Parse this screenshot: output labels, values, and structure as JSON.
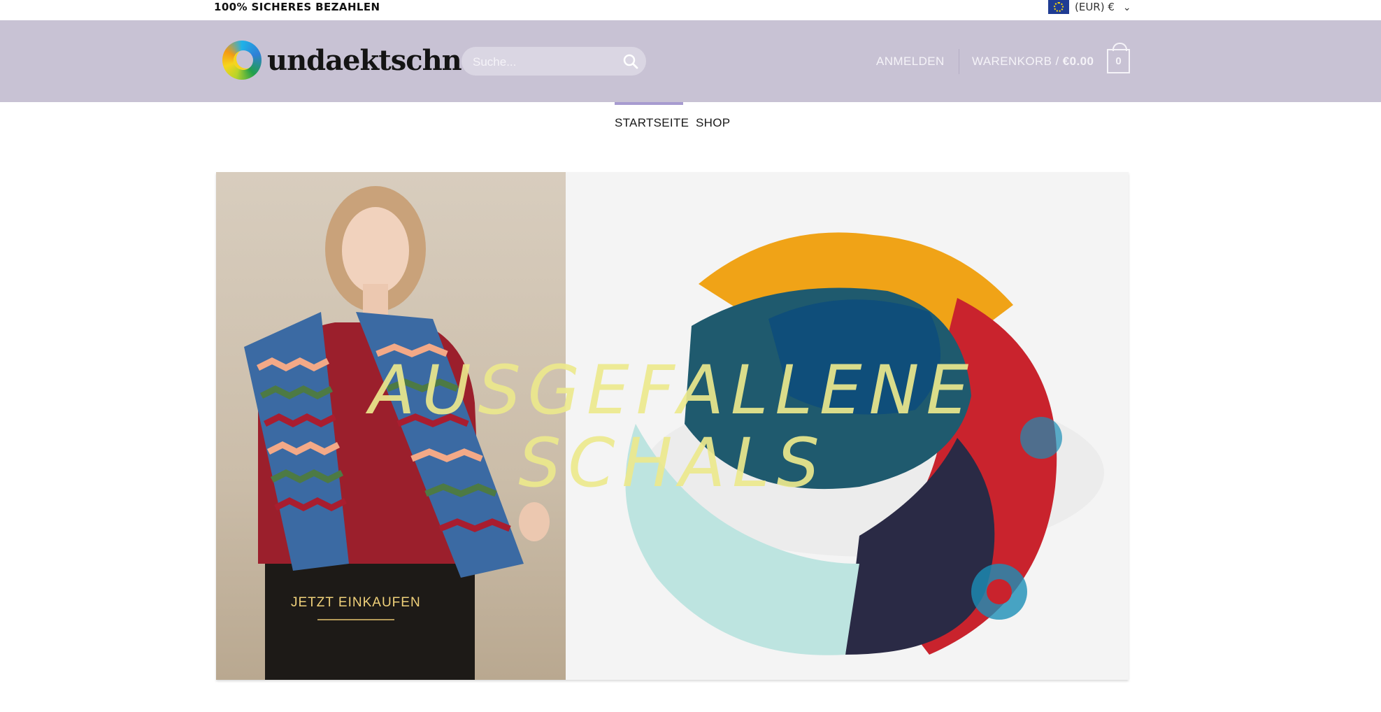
{
  "topbar": {
    "secure_payment": "100% SICHERES BEZAHLEN",
    "currency": "(EUR) €"
  },
  "header": {
    "logo_text": "undaektschn",
    "search_placeholder": "Suche...",
    "login": "ANMELDEN",
    "cart_label": "WARENKORB / ",
    "cart_amount": "€0.00",
    "cart_count": "0"
  },
  "nav": {
    "items": [
      {
        "label": "STARTSEITE",
        "active": true
      },
      {
        "label": "SHOP",
        "active": false
      }
    ]
  },
  "hero": {
    "title_line1": "AUSGEFALLENE",
    "title_line2": "SCHALS",
    "cta": "JETZT EINKAUFEN"
  },
  "colors": {
    "header_bg": "#c8c2d4",
    "accent_nav": "#a79bd0",
    "hero_title": "#ece88c",
    "cta": "#f0d17a"
  }
}
